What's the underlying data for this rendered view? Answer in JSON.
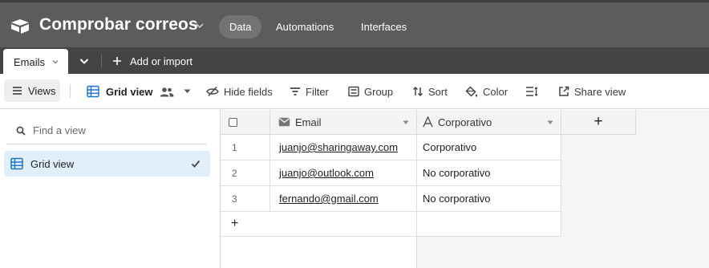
{
  "header": {
    "base_title": "Comprobar correos",
    "nav_tabs": [
      {
        "label": "Data",
        "active": true
      },
      {
        "label": "Automations",
        "active": false
      },
      {
        "label": "Interfaces",
        "active": false
      }
    ]
  },
  "tables_bar": {
    "active_table": "Emails",
    "add_import_label": "Add or import"
  },
  "toolbar": {
    "views_label": "Views",
    "view_name": "Grid view",
    "hide_fields": "Hide fields",
    "filter": "Filter",
    "group": "Group",
    "sort": "Sort",
    "color": "Color",
    "share_view": "Share view"
  },
  "sidebar": {
    "search_placeholder": "Find a view",
    "views": [
      {
        "label": "Grid view",
        "selected": true
      }
    ]
  },
  "grid": {
    "columns": [
      {
        "name": "Email",
        "icon": "email-icon"
      },
      {
        "name": "Corporativo",
        "icon": "text-field-icon"
      }
    ],
    "add_field_symbol": "+",
    "add_row_symbol": "+",
    "rows": [
      {
        "num": "1",
        "email": "juanjo@sharingaway.com",
        "corporativo": "Corporativo"
      },
      {
        "num": "2",
        "email": "juanjo@outlook.com",
        "corporativo": "No corporativo"
      },
      {
        "num": "3",
        "email": "fernando@gmail.com",
        "corporativo": "No corporativo"
      }
    ]
  },
  "colors": {
    "header_bg": "#5c5c5c",
    "tabs_bar_bg": "#444444",
    "selected_view_bg": "#e1eefb",
    "accent_blue": "#1a73d8"
  }
}
